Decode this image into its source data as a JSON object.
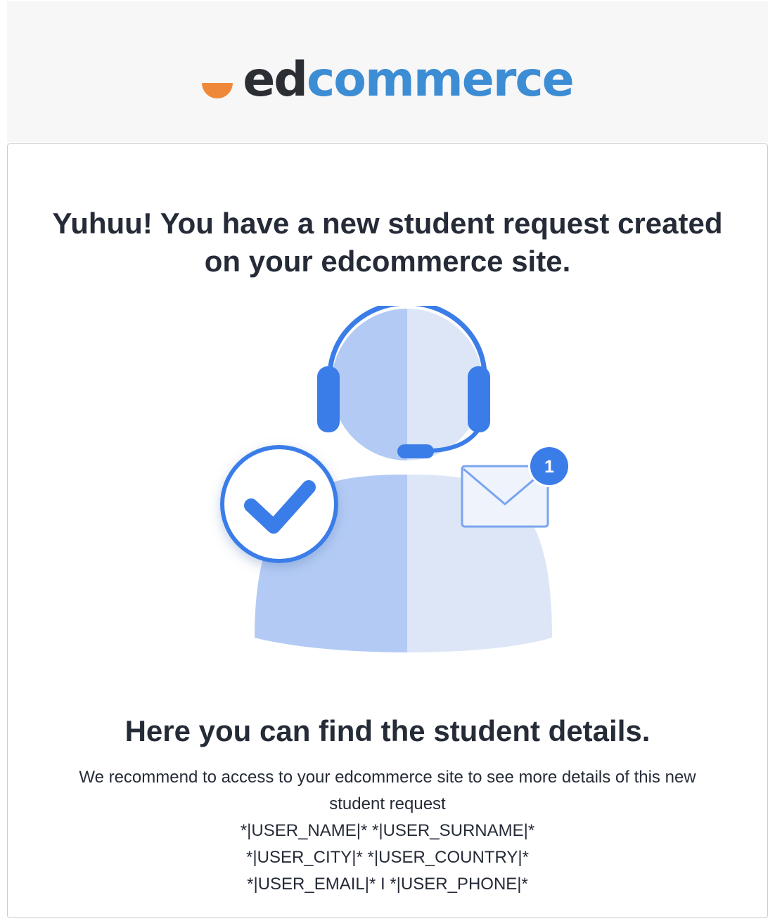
{
  "brand": {
    "logo_ed": "ed",
    "logo_commerce": "commerce",
    "accent_orange": "#f0883a",
    "accent_blue": "#3c8dd3"
  },
  "email": {
    "headline": "Yuhuu! You have a new student request created on your edcommerce site.",
    "illustration": {
      "icon": "support-agent-icon",
      "badge_count": "1"
    },
    "subheadline": "Here you can find the student details.",
    "recommendation": "We recommend to access to your edcommerce site to see more details of this new student request",
    "user_name_line": "*|USER_NAME|* *|USER_SURNAME|*",
    "user_location_line": "*|USER_CITY|* *|USER_COUNTRY|*",
    "user_contact_line": "*|USER_EMAIL|* I *|USER_PHONE|*"
  }
}
